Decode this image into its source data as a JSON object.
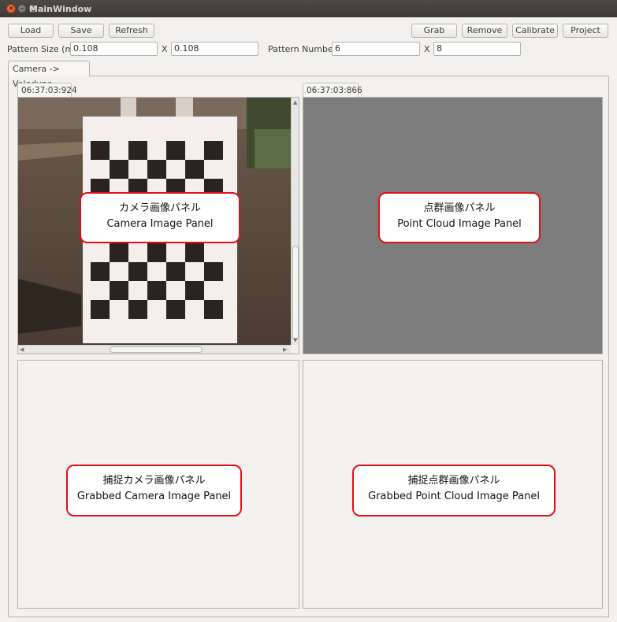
{
  "window": {
    "title": "MainWindow"
  },
  "toolbar": {
    "load_label": "Load",
    "save_label": "Save",
    "refresh_label": "Refresh",
    "grab_label": "Grab",
    "remove_label": "Remove",
    "calibrate_label": "Calibrate",
    "project_label": "Project"
  },
  "pattern": {
    "size_label": "Pattern Size (m)",
    "size_x": "0.108",
    "size_sep": "X",
    "size_y": "0.108",
    "number_label": "Pattern Number",
    "number_x": "6",
    "number_sep": "X",
    "number_y": "8"
  },
  "tabs": [
    {
      "label": "Camera -> Velodyne"
    }
  ],
  "camera_panel": {
    "timestamp": "06:37:03:924"
  },
  "pointcloud_panel": {
    "timestamp": "06:37:03:866"
  },
  "callouts": {
    "camera_jp": "カメラ画像パネル",
    "camera_en": "Camera Image Panel",
    "pointcloud_jp": "点群画像パネル",
    "pointcloud_en": "Point Cloud Image Panel",
    "grabbed_camera_jp": "捕捉カメラ画像パネル",
    "grabbed_camera_en": "Grabbed Camera Image Panel",
    "grabbed_pointcloud_jp": "捕捉点群画像パネル",
    "grabbed_pointcloud_en": "Grabbed Point Cloud Image Panel"
  },
  "colors": {
    "callout_border": "#e0101a",
    "pointcloud_bg": "#7c7c7c",
    "titlebar": "#3b3a36"
  }
}
